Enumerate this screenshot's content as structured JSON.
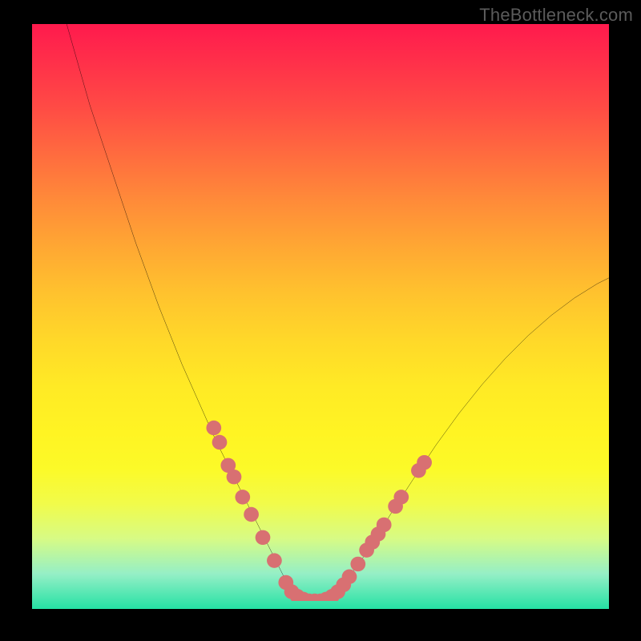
{
  "watermark": "TheBottleneck.com",
  "chart_data": {
    "type": "line",
    "title": "",
    "xlabel": "",
    "ylabel": "",
    "xlim": [
      0,
      100
    ],
    "ylim": [
      0,
      100
    ],
    "background_gradient": {
      "top": "#ff1a4d",
      "mid": "#ffe425",
      "bottom": "#25e1a4"
    },
    "series": [
      {
        "name": "curve",
        "stroke": "#000000",
        "x": [
          6,
          8,
          10,
          12,
          14,
          16,
          18,
          20,
          22,
          24,
          26,
          28,
          30,
          32,
          34,
          36,
          38,
          40,
          41,
          42,
          43,
          44,
          46,
          48,
          50,
          52,
          54,
          56,
          58,
          60,
          62,
          66,
          70,
          74,
          78,
          82,
          86,
          90,
          94,
          98,
          100
        ],
        "y": [
          100,
          93,
          86,
          80,
          74,
          68,
          62,
          56.5,
          51,
          46,
          41,
          36.5,
          32,
          27.5,
          23.5,
          19.5,
          15.5,
          11.5,
          9.5,
          7.5,
          5.5,
          3.5,
          1,
          0,
          0,
          0.8,
          2.8,
          5.6,
          8.4,
          11.5,
          14.8,
          21,
          27,
          32.5,
          37.5,
          42,
          46,
          49.5,
          52.5,
          55,
          56
        ]
      }
    ],
    "markers": {
      "name": "dots",
      "fill": "#d87072",
      "radius_pct": 1.3,
      "points": [
        {
          "x": 31.5,
          "y": 30
        },
        {
          "x": 32.5,
          "y": 27.5
        },
        {
          "x": 34,
          "y": 23.5
        },
        {
          "x": 35,
          "y": 21.5
        },
        {
          "x": 36.5,
          "y": 18
        },
        {
          "x": 38,
          "y": 15
        },
        {
          "x": 40,
          "y": 11
        },
        {
          "x": 42,
          "y": 7
        },
        {
          "x": 44,
          "y": 3.2
        },
        {
          "x": 45,
          "y": 1.6
        },
        {
          "x": 46,
          "y": 0.8
        },
        {
          "x": 47,
          "y": 0.3
        },
        {
          "x": 48,
          "y": 0
        },
        {
          "x": 49,
          "y": 0
        },
        {
          "x": 50,
          "y": 0
        },
        {
          "x": 51,
          "y": 0.3
        },
        {
          "x": 52,
          "y": 0.8
        },
        {
          "x": 53,
          "y": 1.6
        },
        {
          "x": 54,
          "y": 2.8
        },
        {
          "x": 55,
          "y": 4.2
        },
        {
          "x": 56.5,
          "y": 6.4
        },
        {
          "x": 58,
          "y": 8.8
        },
        {
          "x": 59,
          "y": 10.2
        },
        {
          "x": 60,
          "y": 11.6
        },
        {
          "x": 61,
          "y": 13.2
        },
        {
          "x": 63,
          "y": 16.4
        },
        {
          "x": 64,
          "y": 18
        },
        {
          "x": 67,
          "y": 22.6
        },
        {
          "x": 68,
          "y": 24
        }
      ]
    }
  }
}
